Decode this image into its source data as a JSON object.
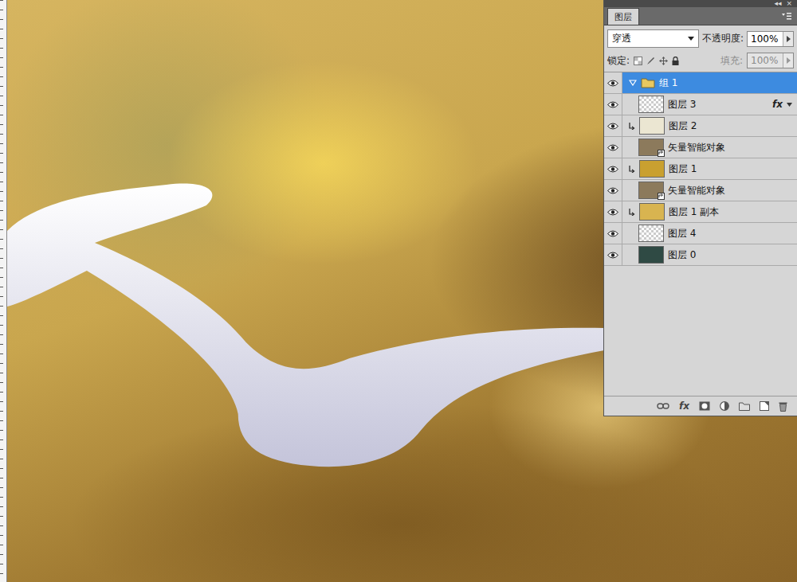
{
  "panel": {
    "title": "图层",
    "collapse": "◂◂",
    "close": "×",
    "blend_mode": "穿透",
    "opacity_label": "不透明度:",
    "opacity": "100%",
    "lock_label": "锁定:",
    "fill_label": "填充:",
    "fill": "100%",
    "fill_disabled": true,
    "footer_fx": "fx"
  },
  "layers": [
    {
      "name": "组 1",
      "kind": "group",
      "visible": true,
      "selected": true,
      "expanded": true,
      "clipped": false,
      "badge": "",
      "color": "#e8c860"
    },
    {
      "name": "图层 3",
      "kind": "layer",
      "visible": true,
      "selected": false,
      "expanded": false,
      "clipped": false,
      "badge": "fx",
      "color": ""
    },
    {
      "name": "图层 2",
      "kind": "layer",
      "visible": true,
      "selected": false,
      "expanded": false,
      "clipped": true,
      "badge": "",
      "color": "#ebe6d2"
    },
    {
      "name": "矢量智能对象",
      "kind": "smart",
      "visible": true,
      "selected": false,
      "expanded": false,
      "clipped": false,
      "badge": "",
      "color": "#8c7a5c"
    },
    {
      "name": "图层 1",
      "kind": "layer",
      "visible": true,
      "selected": false,
      "expanded": false,
      "clipped": true,
      "badge": "",
      "color": "#c9a030"
    },
    {
      "name": "矢量智能对象",
      "kind": "smart",
      "visible": true,
      "selected": false,
      "expanded": false,
      "clipped": false,
      "badge": "",
      "color": "#8c7a5c"
    },
    {
      "name": "图层 1 副本",
      "kind": "layer",
      "visible": true,
      "selected": false,
      "expanded": false,
      "clipped": true,
      "badge": "",
      "color": "#d8b450"
    },
    {
      "name": "图层 4",
      "kind": "layer",
      "visible": true,
      "selected": false,
      "expanded": false,
      "clipped": false,
      "badge": "",
      "color": ""
    },
    {
      "name": "图层 0",
      "kind": "layer",
      "visible": true,
      "selected": false,
      "expanded": false,
      "clipped": false,
      "badge": "",
      "color": "#2f4a44"
    }
  ]
}
